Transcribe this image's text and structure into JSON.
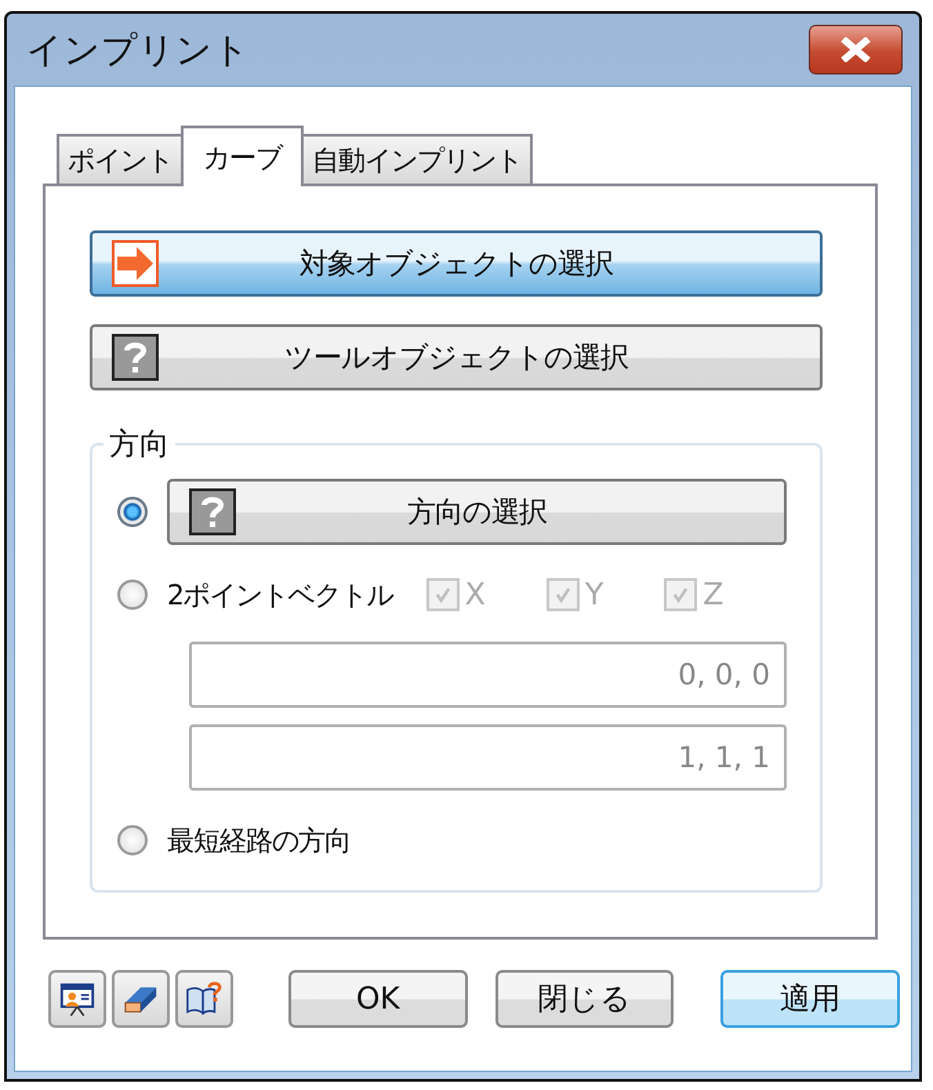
{
  "window": {
    "title": "インプリント"
  },
  "tabs": [
    {
      "label": "ポイント",
      "selected": false
    },
    {
      "label": "カーブ",
      "selected": true
    },
    {
      "label": "自動インプリント",
      "selected": false
    }
  ],
  "selection_buttons": [
    {
      "label": "対象オブジェクトの選択",
      "kind": "arrow",
      "highlighted": true
    },
    {
      "label": "ツールオブジェクトの選択",
      "kind": "question",
      "highlighted": false
    }
  ],
  "direction": {
    "title": "方向",
    "options": [
      {
        "kind": "button",
        "selected": true,
        "button": {
          "label": "方向の選択",
          "kind": "question",
          "highlighted": false
        }
      },
      {
        "kind": "vector",
        "selected": false,
        "label": "2ポイントベクトル",
        "axes": [
          {
            "label": "X",
            "checked": true
          },
          {
            "label": "Y",
            "checked": true
          },
          {
            "label": "Z",
            "checked": true
          }
        ],
        "disabled": true,
        "fields": [
          "0, 0, 0",
          "1, 1, 1"
        ]
      },
      {
        "kind": "plain",
        "selected": false,
        "label": "最短経路の方向"
      }
    ]
  },
  "footer": {
    "icons": [
      {
        "kind": "presentation"
      },
      {
        "kind": "eraser"
      },
      {
        "kind": "help"
      }
    ],
    "buttons": [
      {
        "label": "OK",
        "default": false
      },
      {
        "label": "閉じる",
        "default": false
      },
      {
        "label": "適用",
        "default": true
      }
    ]
  }
}
